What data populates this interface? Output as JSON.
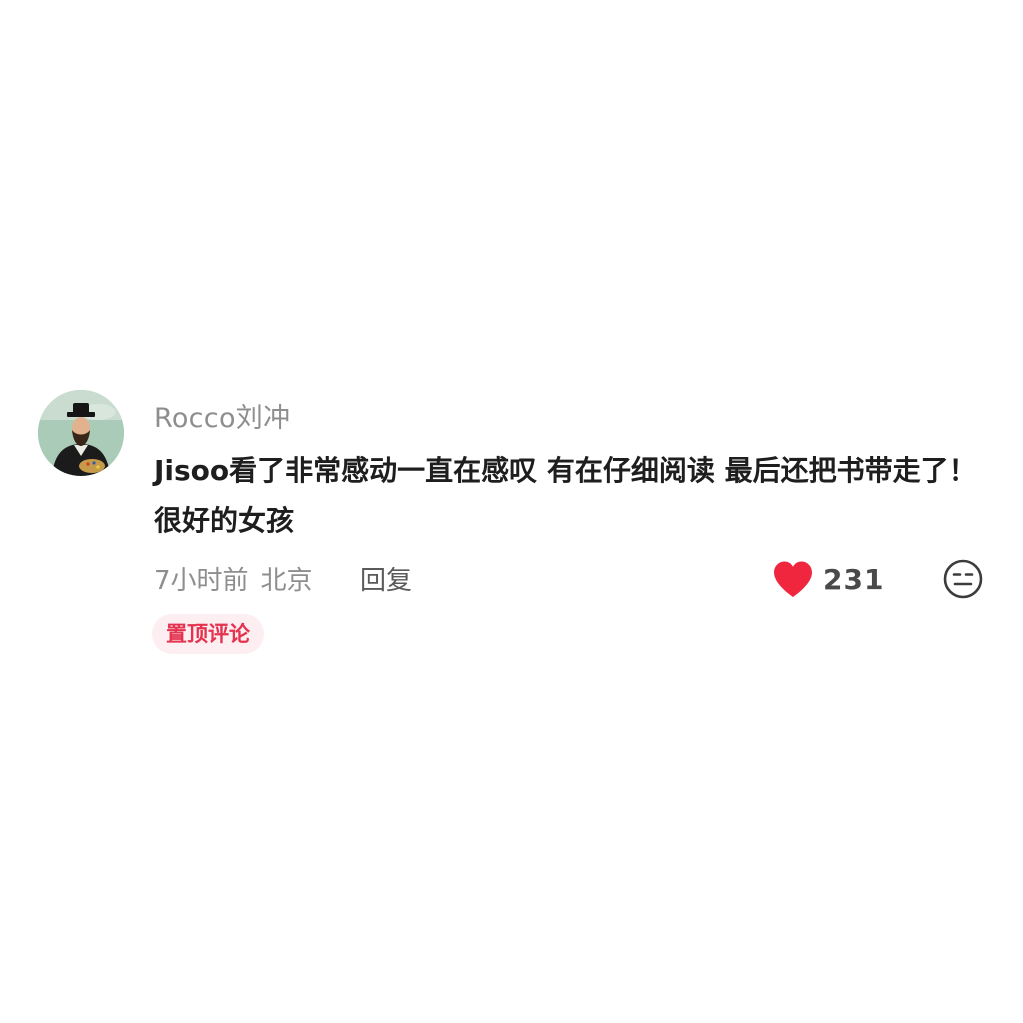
{
  "comment": {
    "avatar_icon": "portrait-avatar-icon",
    "username": "Rocco刘冲",
    "text": "Jisoo看了非常感动一直在感叹 有在仔细阅读 最后还把书带走了！很好的女孩",
    "time": "7小时前",
    "location": "北京",
    "reply_label": "回复",
    "like_icon": "heart-icon",
    "like_count": "231",
    "emoji_icon": "expressionless-face-icon",
    "pinned_label": "置顶评论",
    "colors": {
      "heart": "#f0263f",
      "pin_text": "#e4324f",
      "pin_bg": "#fdeef1",
      "secondary_text": "#8e8e8e"
    }
  }
}
